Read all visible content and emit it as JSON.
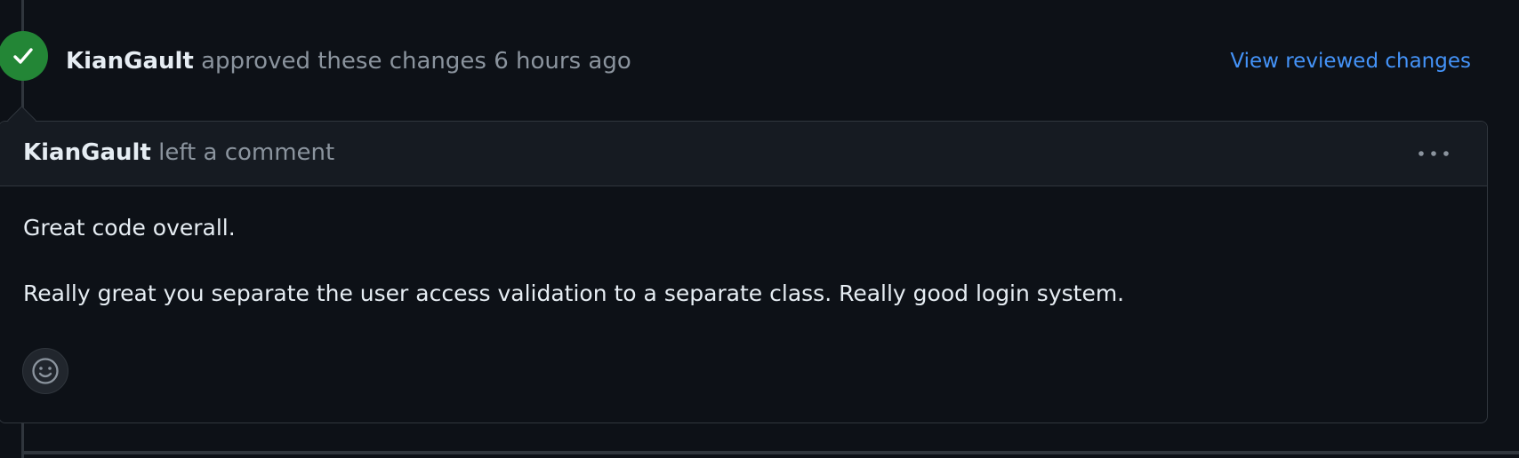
{
  "review_event": {
    "author": "KianGault",
    "action_text": "approved these changes",
    "timestamp": "6 hours ago",
    "view_link_label": "View reviewed changes",
    "status_icon": "check-icon",
    "status_color": "#238636"
  },
  "comment": {
    "author": "KianGault",
    "action_text": "left a comment",
    "menu_icon": "kebab-horizontal-icon",
    "body": [
      "Great code overall.",
      "Really great you separate the user access validation to a separate class. Really good login system."
    ],
    "reaction_icon": "smiley-icon"
  },
  "colors": {
    "background": "#0d1117",
    "header_background": "#161b22",
    "border": "#30363d",
    "text_primary": "#e6edf3",
    "text_muted": "#8b949e",
    "link": "#4493f8"
  }
}
